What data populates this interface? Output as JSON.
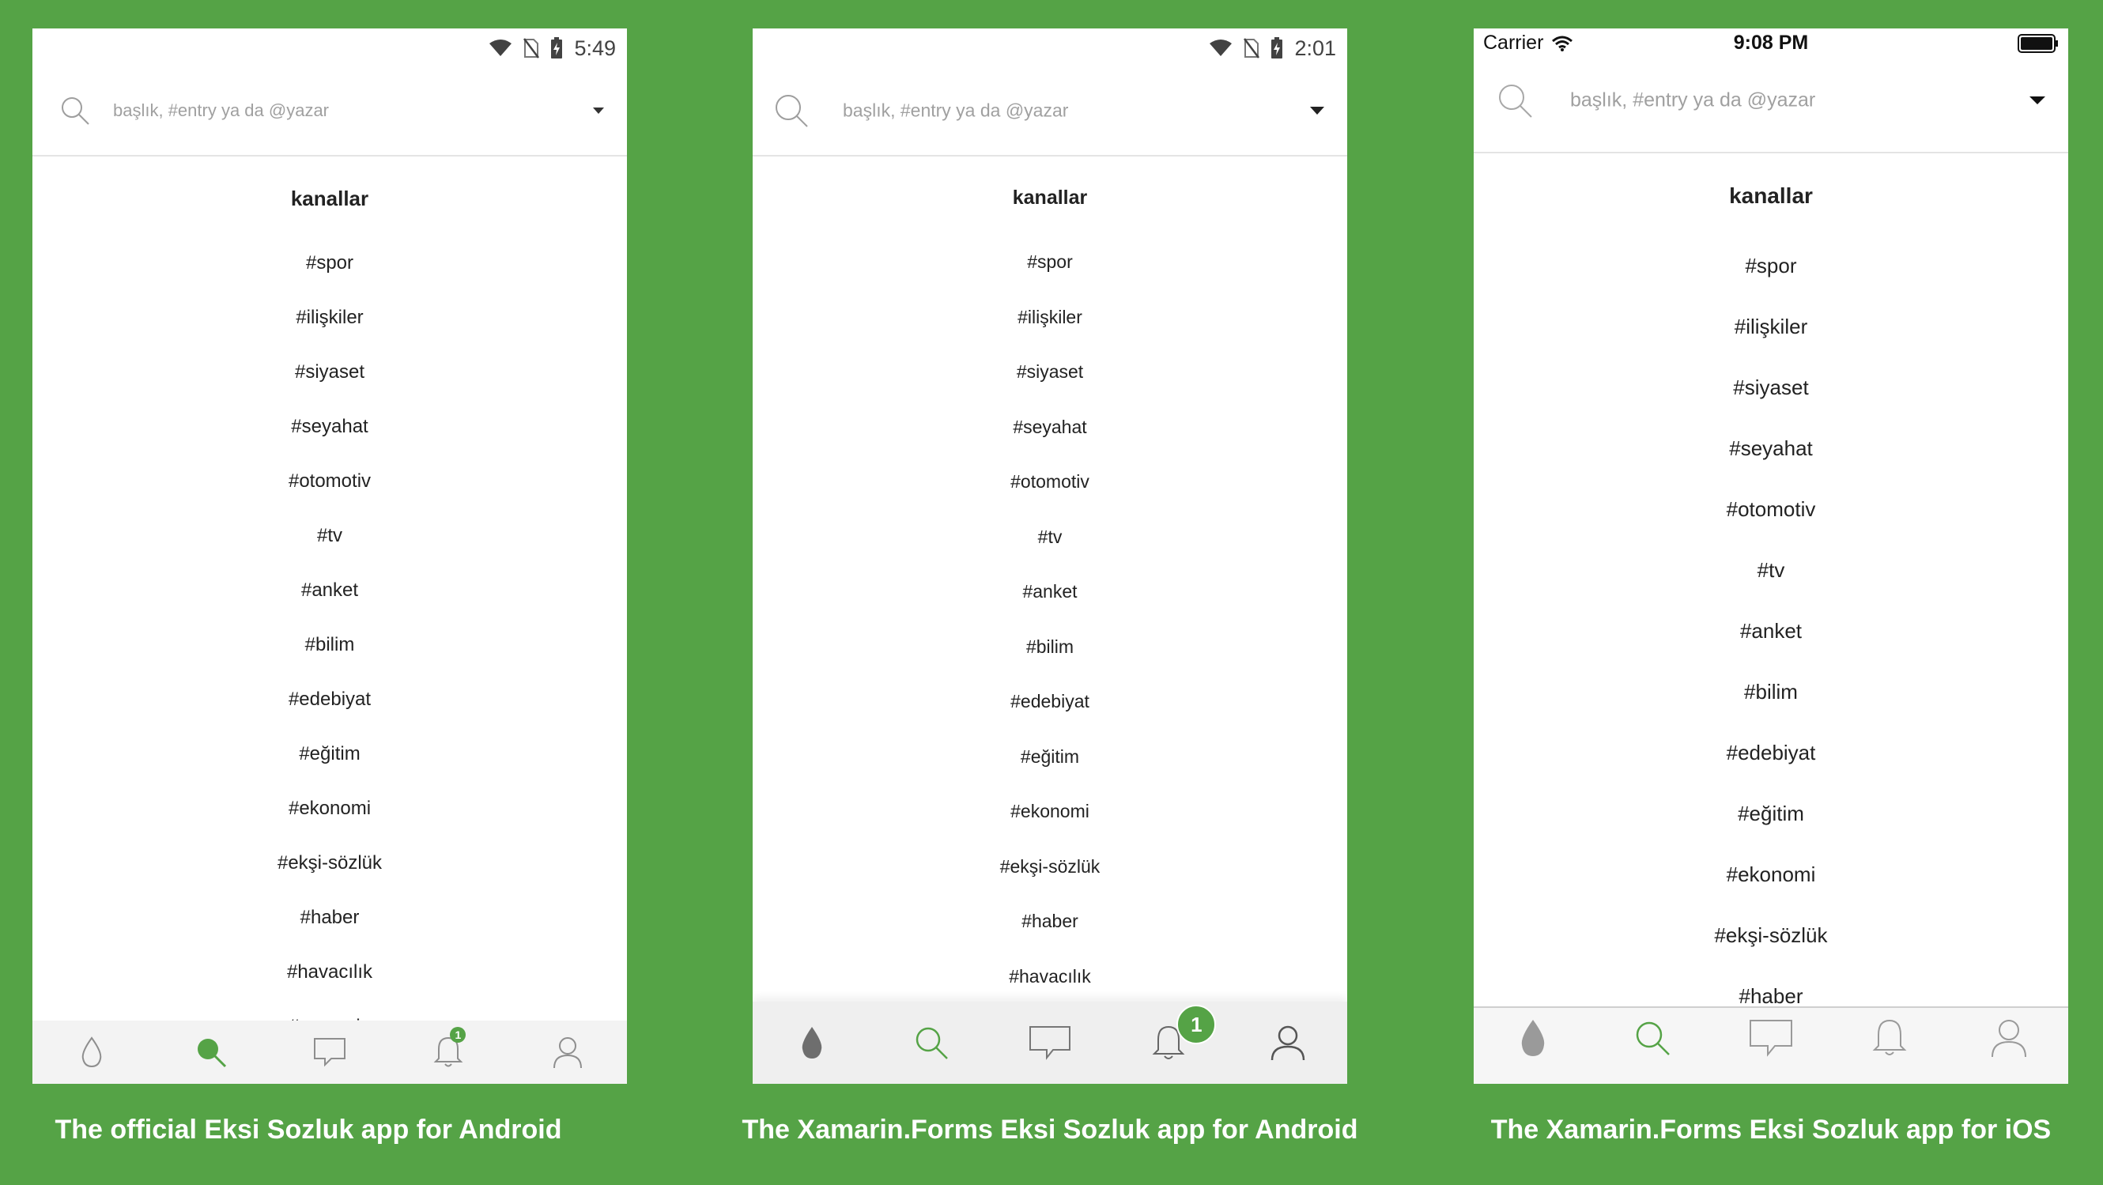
{
  "colors": {
    "background": "#55a346",
    "accent": "#55a346",
    "icon": "#8e8e8e",
    "icon_dark": "#555555"
  },
  "search": {
    "placeholder": "başlık, #entry ya da @yazar"
  },
  "heading": "kanallar",
  "channels": [
    "#spor",
    "#ilişkiler",
    "#siyaset",
    "#seyahat",
    "#otomotiv",
    "#tv",
    "#anket",
    "#bilim",
    "#edebiyat",
    "#eğitim",
    "#ekonomi",
    "#ekşi-sözlük",
    "#haber",
    "#havacılık",
    "#magazin"
  ],
  "phones": [
    {
      "status_time": "5:49",
      "visible_channel_count": 15,
      "notification_badge": "1",
      "caption": "The official Eksi Sozluk app for Android",
      "tabs": [
        "drop-icon",
        "search-icon",
        "messages-icon",
        "bell-icon",
        "profile-icon"
      ]
    },
    {
      "status_time": "2:01",
      "visible_channel_count": 14,
      "notification_badge": "1",
      "caption": "The Xamarin.Forms Eksi Sozluk app for Android",
      "tabs": [
        "drop-icon",
        "search-icon",
        "messages-icon",
        "bell-icon",
        "profile-icon"
      ]
    },
    {
      "status_carrier": "Carrier",
      "status_time": "9:08 PM",
      "visible_channel_count": 13,
      "caption": "The Xamarin.Forms Eksi Sozluk app for iOS",
      "tabs": [
        "drop-icon",
        "search-icon",
        "messages-icon",
        "bell-icon",
        "profile-icon"
      ]
    }
  ]
}
